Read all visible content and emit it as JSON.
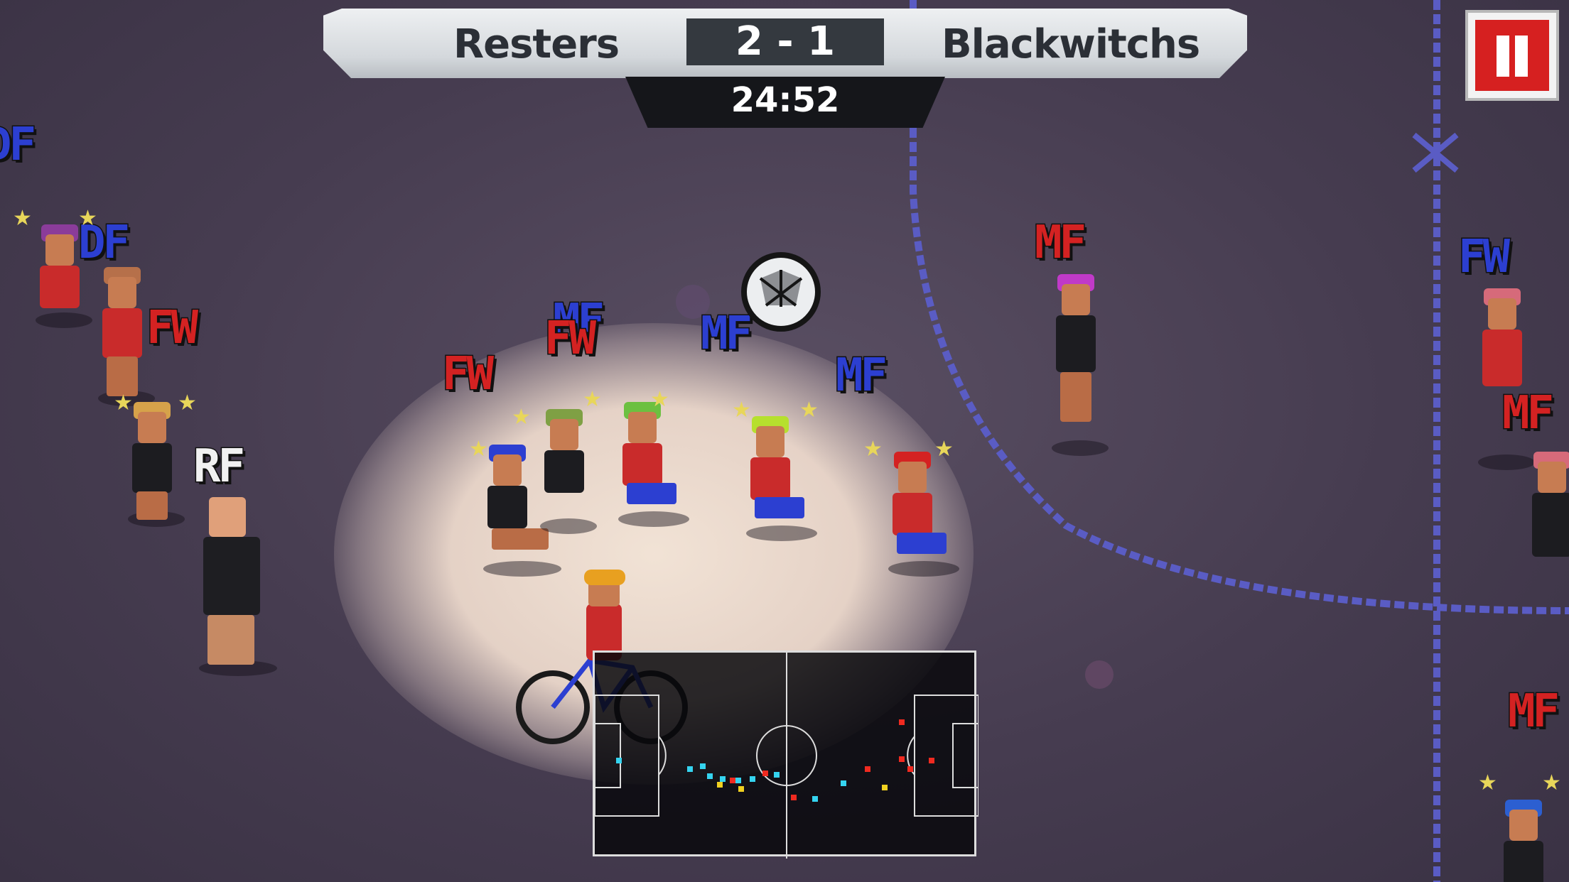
{
  "scoreboard": {
    "home_team": "Resters",
    "away_team": "Blackwitchs",
    "score": "2 - 1",
    "clock": "24:52"
  },
  "role_tags": [
    "DF",
    "DF",
    "FW",
    "RF",
    "FW",
    "MF",
    "FW",
    "MF",
    "MF",
    "MF",
    "FW",
    "MF",
    "MF"
  ],
  "colors": {
    "home_tag": "#d42222",
    "away_tag": "#2c3fd1",
    "referee_tag": "#f1f1f1",
    "pause_button": "#d62020",
    "pitch": "#463c50"
  },
  "icons": [
    "pause-icon",
    "ball-icon",
    "minimap",
    "star-icon"
  ]
}
